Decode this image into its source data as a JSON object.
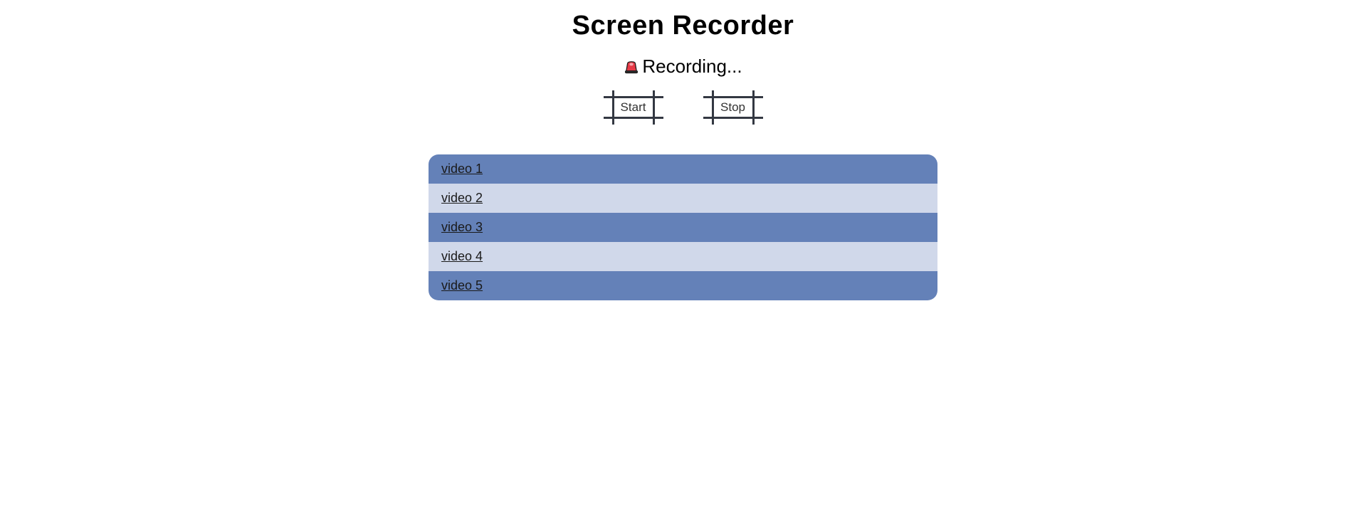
{
  "title": "Screen Recorder",
  "status": {
    "text": "Recording...",
    "icon": "siren-icon"
  },
  "buttons": {
    "start": "Start",
    "stop": "Stop"
  },
  "videos": [
    {
      "label": "video 1"
    },
    {
      "label": "video 2"
    },
    {
      "label": "video 3"
    },
    {
      "label": "video 4"
    },
    {
      "label": "video 5"
    }
  ]
}
